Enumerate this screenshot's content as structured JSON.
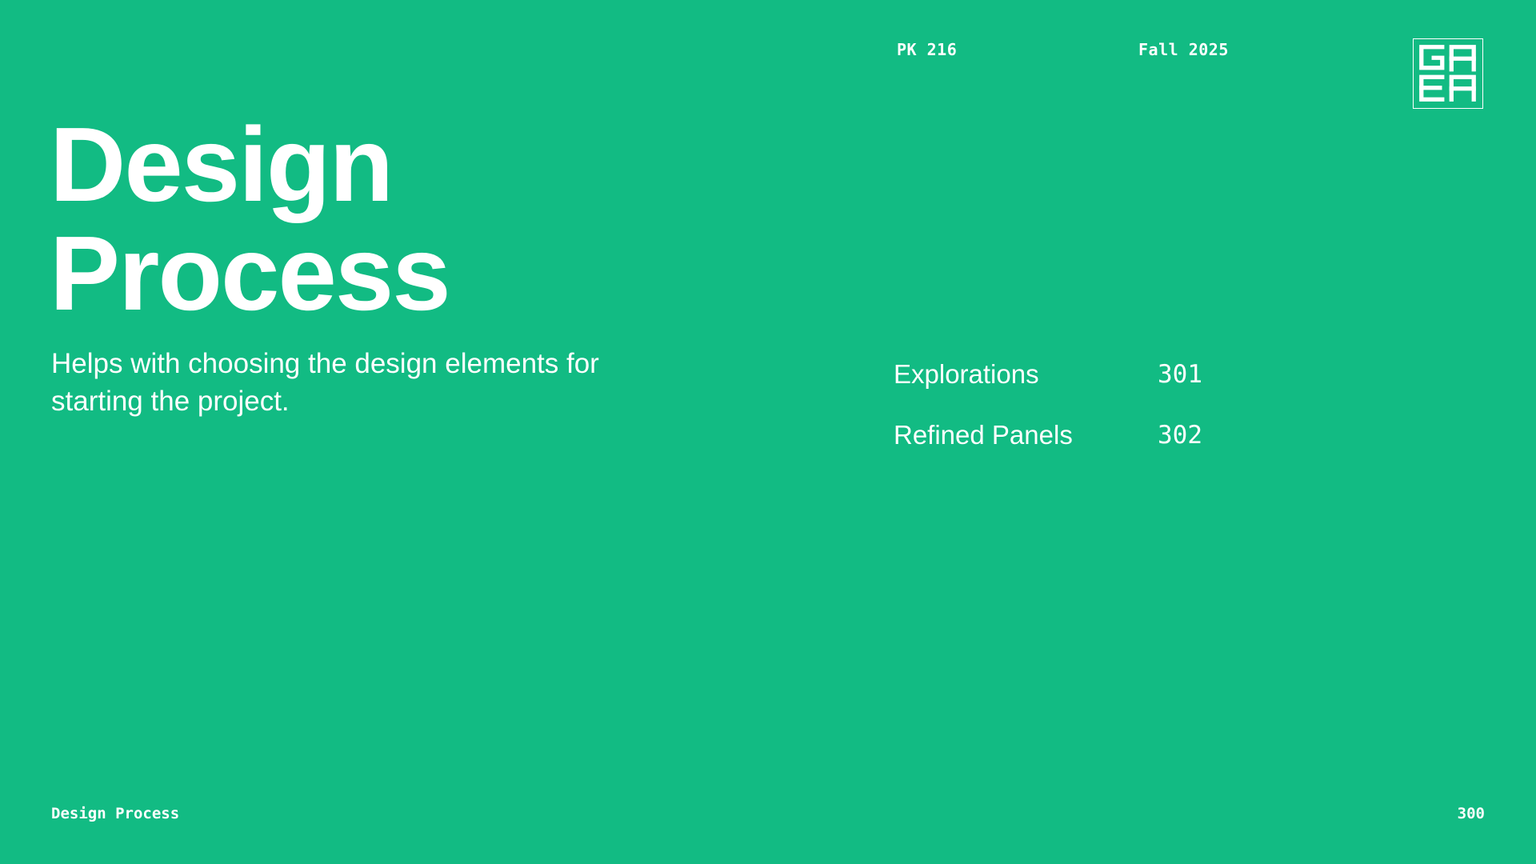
{
  "header": {
    "course_code": "PK 216",
    "term": "Fall 2025",
    "logo_text": "GAEA"
  },
  "title": {
    "line1": "Design",
    "line2": "Process"
  },
  "subtitle": "Helps with choosing the design elements for starting the project.",
  "toc": {
    "items": [
      {
        "label": "Explorations",
        "number": "301"
      },
      {
        "label": "Refined Panels",
        "number": "302"
      }
    ]
  },
  "footer": {
    "section_title": "Design Process",
    "page_number": "300"
  },
  "colors": {
    "background": "#12BB83",
    "foreground": "#FFFFFF"
  },
  "icons": {
    "logo": "gaea-logo-icon"
  }
}
